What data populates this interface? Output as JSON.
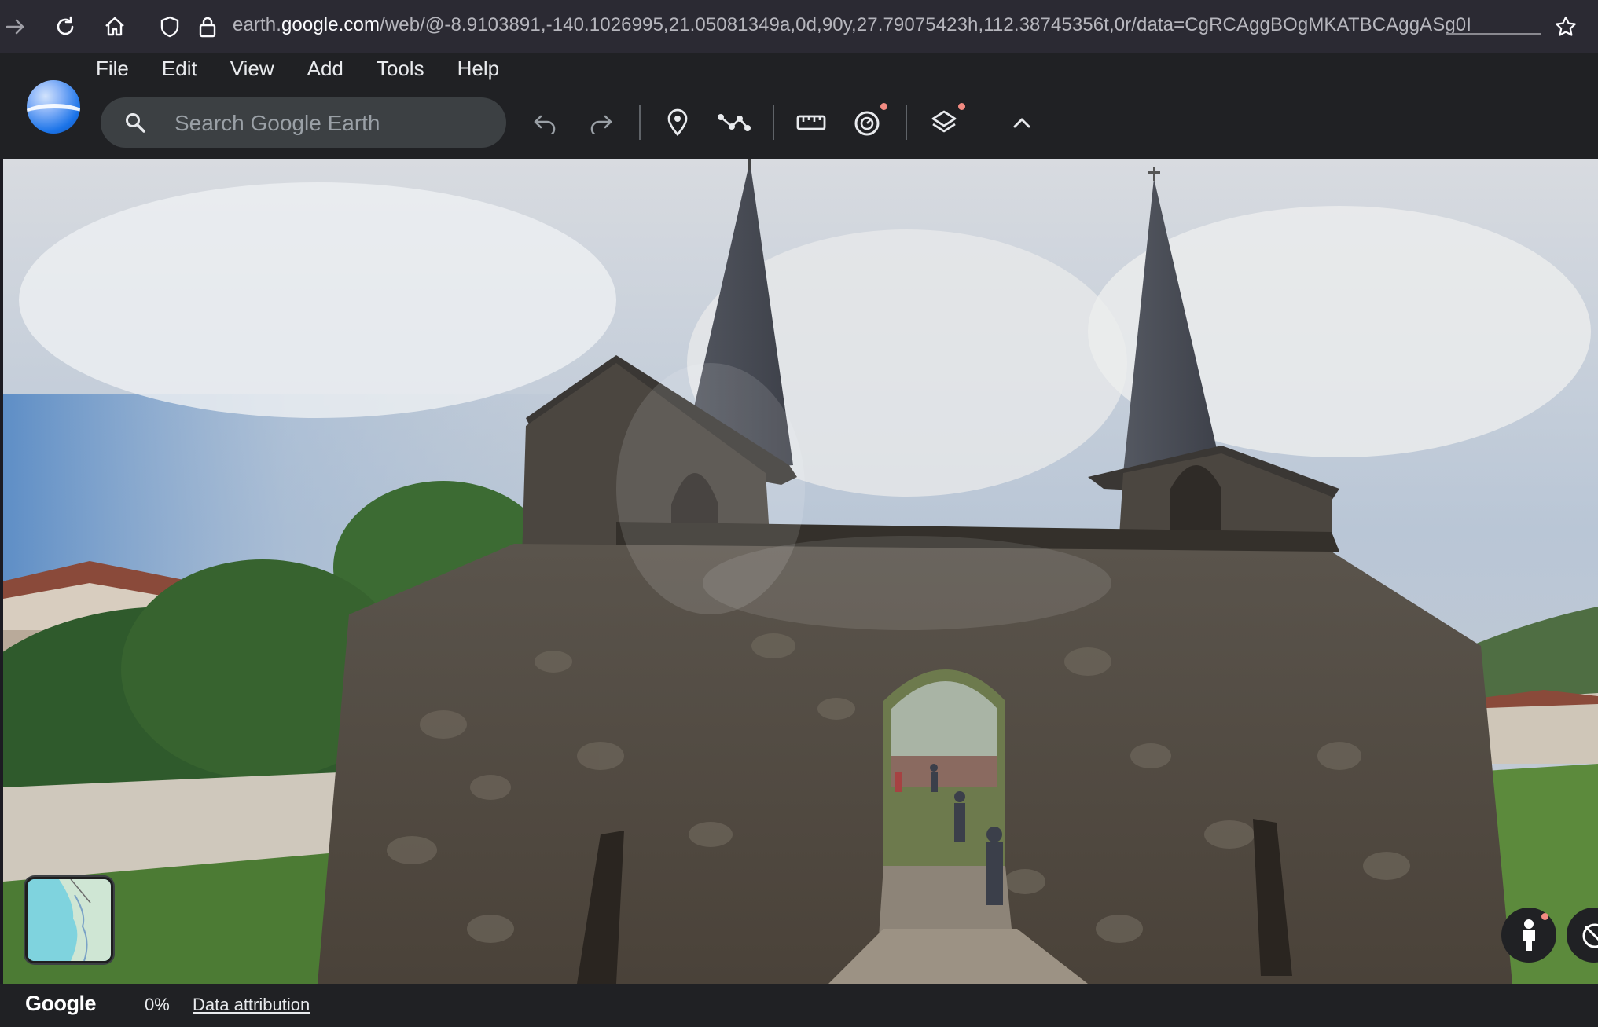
{
  "browser": {
    "url_domain_pre": "earth.",
    "url_domain": "google.com",
    "url_path": "/web/@-8.9103891,-140.1026995,21.05081349a,0d,90y,27.79075423h,112.38745356t,0r/data=CgRCAggBOgMKATBCAggASg0I",
    "icons": [
      "forward-icon",
      "reload-icon",
      "home-icon",
      "shield-icon",
      "lock-icon",
      "bookmark-star-icon"
    ]
  },
  "menu": {
    "items": [
      "File",
      "Edit",
      "View",
      "Add",
      "Tools",
      "Help"
    ]
  },
  "search": {
    "placeholder": "Search Google Earth"
  },
  "toolbar": {
    "icons": [
      "undo-icon",
      "redo-icon",
      "placemark-icon",
      "path-icon",
      "ruler-icon",
      "voyager-icon",
      "layers-icon",
      "collapse-chevron-icon"
    ]
  },
  "footer": {
    "brand": "Google",
    "loading_percent": "0%",
    "attribution": "Data attribution"
  },
  "colors": {
    "chrome_bg": "#2b2a33",
    "header_bg": "#202124",
    "search_bg": "#3c4043",
    "notification_dot": "#f28b82"
  }
}
